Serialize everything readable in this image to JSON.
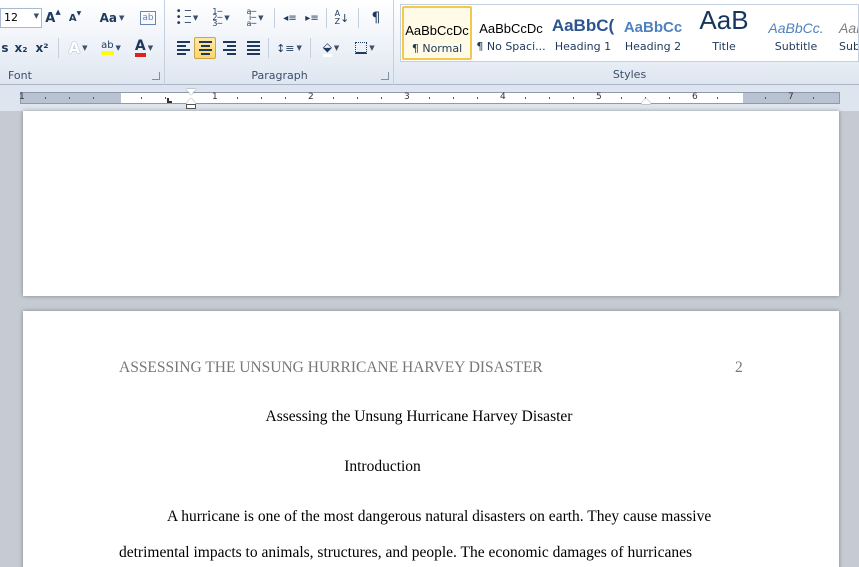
{
  "ribbon": {
    "font_group": {
      "label": "Font",
      "font_size": "12",
      "grow_font": "A",
      "shrink_font": "A",
      "change_case": "Aa",
      "clear_format": "ab",
      "subscript": "x₂",
      "superscript": "x²",
      "text_effects": "A",
      "highlight": "ab",
      "font_color": "A"
    },
    "paragraph_group": {
      "label": "Paragraph",
      "sort": "A↓Z",
      "show_marks": "¶"
    },
    "styles_group": {
      "label": "Styles",
      "tiles": [
        {
          "sample": "AaBbCcDc",
          "name": "¶ Normal"
        },
        {
          "sample": "AaBbCcDc",
          "name": "¶ No Spaci..."
        },
        {
          "sample": "AaBbC(",
          "name": "Heading 1"
        },
        {
          "sample": "AaBbCc",
          "name": "Heading 2"
        },
        {
          "sample": "AaB",
          "name": "Title"
        },
        {
          "sample": "AaBbCc.",
          "name": "Subtitle"
        },
        {
          "sample": "AaBb",
          "name": "Subtl"
        }
      ]
    }
  },
  "ruler": {
    "numbers": [
      "1",
      "1",
      "2",
      "3",
      "4",
      "5",
      "6",
      "7"
    ]
  },
  "document": {
    "page2": {
      "running_head": "ASSESSING THE UNSUNG HURRICANE HARVEY DISASTER",
      "page_number": "2",
      "title": "Assessing the Unsung Hurricane Harvey Disaster",
      "heading": "Introduction",
      "para_line1": "A hurricane is one of the most dangerous natural disasters on earth. They cause massive",
      "para_line2": "detrimental impacts to animals, structures, and people. The economic damages of hurricanes"
    }
  }
}
